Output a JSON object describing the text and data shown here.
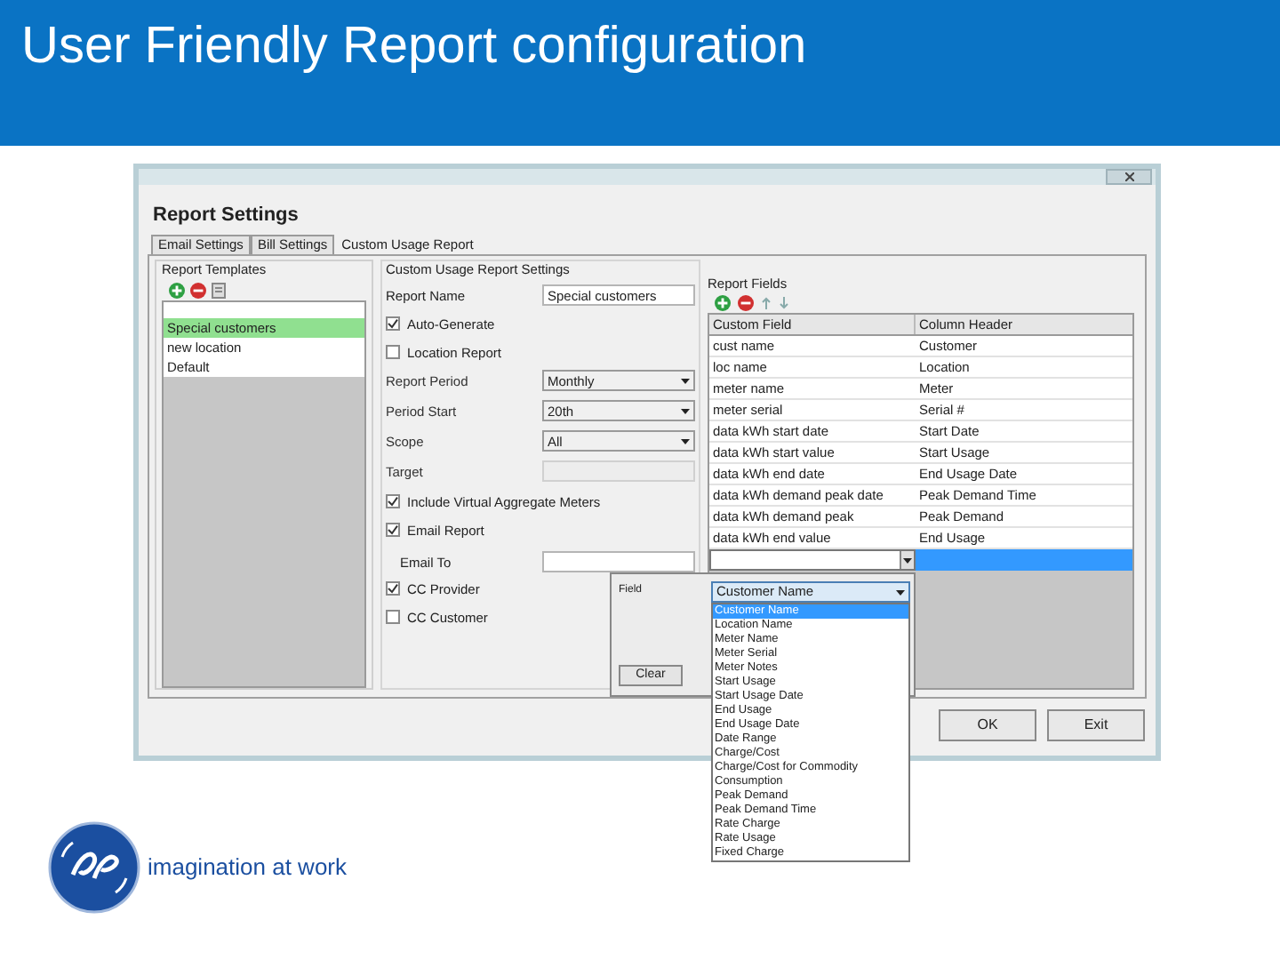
{
  "slide_title": "User Friendly Report configuration",
  "window": {
    "title": "Report Settings",
    "tabs": [
      {
        "label": "Email Settings",
        "selected": false
      },
      {
        "label": "Bill Settings",
        "selected": false
      },
      {
        "label": "Custom Usage Report",
        "selected": true
      }
    ],
    "templates": {
      "title": "Report Templates",
      "items": [
        {
          "label": "Special customers",
          "selected": true
        },
        {
          "label": "new location",
          "selected": false
        },
        {
          "label": "Default",
          "selected": false
        }
      ]
    },
    "settings": {
      "title": "Custom Usage Report Settings",
      "rows": [
        {
          "kind": "text",
          "label": "Report Name",
          "value": "Special customers"
        },
        {
          "kind": "checkbox",
          "label": "Auto-Generate",
          "checked": true
        },
        {
          "kind": "checkbox",
          "label": "Location Report",
          "checked": false
        },
        {
          "kind": "select",
          "label": "Report Period",
          "value": "Monthly",
          "disabled": false
        },
        {
          "kind": "select",
          "label": "Period Start",
          "value": "20th",
          "disabled": false
        },
        {
          "kind": "select",
          "label": "Scope",
          "value": "All",
          "disabled": false
        },
        {
          "kind": "select",
          "label": "Target",
          "disabled": true
        },
        {
          "kind": "checkbox",
          "label": "Include Virtual Aggregate Meters",
          "checked": true
        },
        {
          "kind": "checkbox",
          "label": "Email Report",
          "checked": true
        },
        {
          "kind": "text",
          "label": "Email To",
          "value": ""
        },
        {
          "kind": "checkbox",
          "label": "CC Provider",
          "checked": true
        },
        {
          "kind": "checkbox",
          "label": "CC Customer",
          "checked": false
        }
      ]
    },
    "fields": {
      "title": "Report Fields",
      "columns": [
        "Custom Field",
        "Column Header"
      ],
      "rows": [
        [
          "cust name",
          "Customer"
        ],
        [
          "loc name",
          "Location"
        ],
        [
          "meter name",
          "Meter"
        ],
        [
          "meter serial",
          "Serial #"
        ],
        [
          "data kWh start date",
          "Start Date"
        ],
        [
          "data kWh start value",
          "Start Usage"
        ],
        [
          "data kWh end date",
          "End Usage Date"
        ],
        [
          "data kWh demand peak date",
          "Peak Demand Time"
        ],
        [
          "data kWh demand peak",
          "Peak Demand"
        ],
        [
          "data kWh end value",
          "End Usage"
        ]
      ]
    },
    "field_popup": {
      "label": "Field",
      "value": "Customer Name",
      "clear_button": "Clear",
      "options": [
        {
          "label": "Customer Name",
          "selected": true
        },
        {
          "label": "Location Name",
          "selected": false
        },
        {
          "label": "Meter Name",
          "selected": false
        },
        {
          "label": "Meter Serial",
          "selected": false
        },
        {
          "label": "Meter Notes",
          "selected": false
        },
        {
          "label": "Start Usage",
          "selected": false
        },
        {
          "label": "Start Usage Date",
          "selected": false
        },
        {
          "label": "End Usage",
          "selected": false
        },
        {
          "label": "End Usage Date",
          "selected": false
        },
        {
          "label": "Date Range",
          "selected": false
        },
        {
          "label": "Charge/Cost",
          "selected": false
        },
        {
          "label": "Charge/Cost for Commodity",
          "selected": false
        },
        {
          "label": "Consumption",
          "selected": false
        },
        {
          "label": "Peak Demand",
          "selected": false
        },
        {
          "label": "Peak Demand Time",
          "selected": false
        },
        {
          "label": "Rate Charge",
          "selected": false
        },
        {
          "label": "Rate Usage",
          "selected": false
        },
        {
          "label": "Fixed Charge",
          "selected": false
        }
      ]
    },
    "buttons": [
      "OK",
      "Exit"
    ]
  },
  "footer": {
    "tagline": "imagination at work"
  }
}
